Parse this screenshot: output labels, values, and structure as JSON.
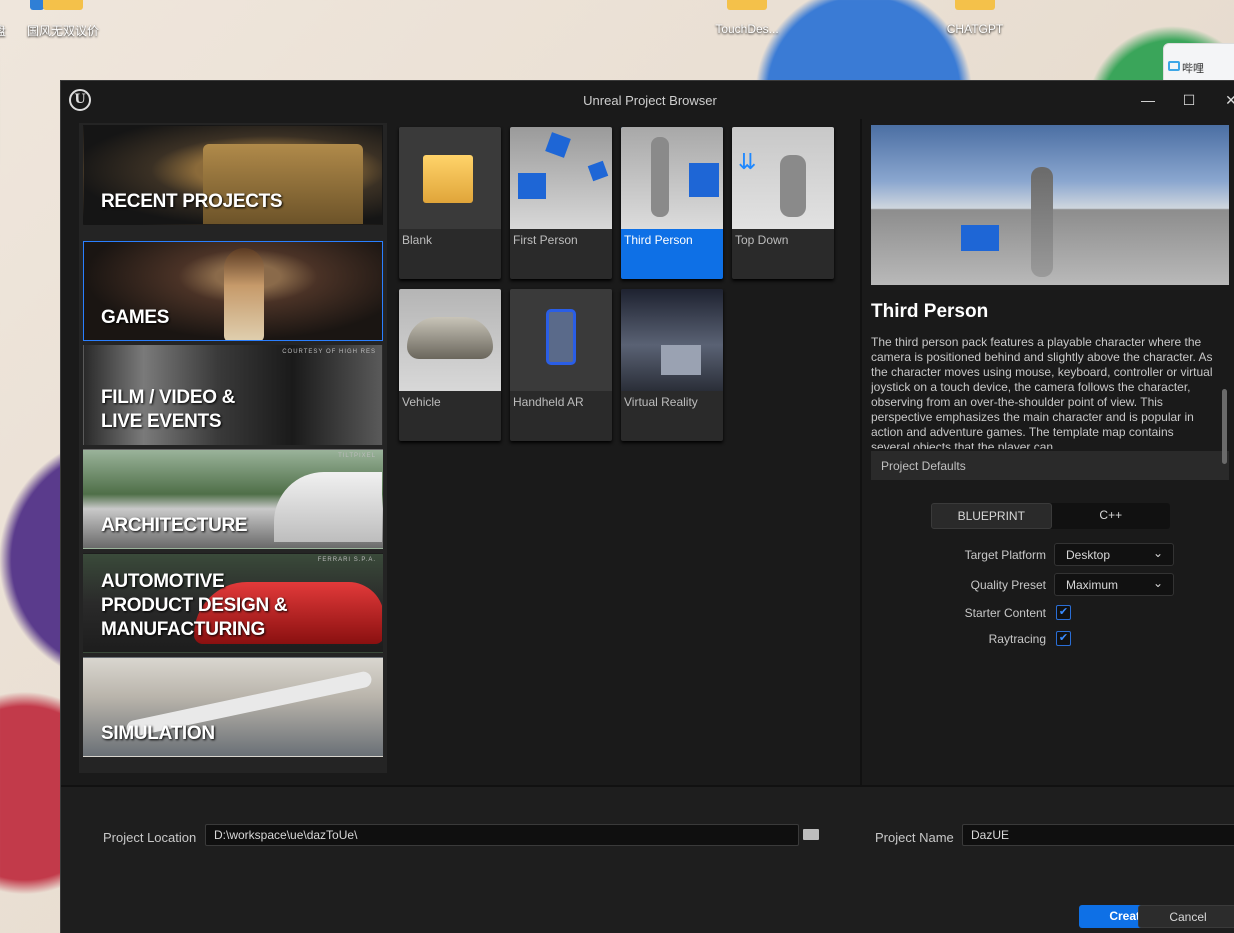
{
  "desktop": {
    "icons": [
      "盘",
      "国风无双议价",
      "TouchDes...",
      "CHATGPT"
    ],
    "edge_app_text": "哔哩"
  },
  "window": {
    "title": "Unreal Project Browser",
    "minimize": "—",
    "maximize": "☐",
    "close": "✕"
  },
  "categories": [
    {
      "label": "RECENT PROJECTS",
      "credit": ""
    },
    {
      "label": "GAMES",
      "credit": ""
    },
    {
      "label": "FILM / VIDEO &\nLIVE EVENTS",
      "credit": "COURTESY OF HIGH RES"
    },
    {
      "label": "ARCHITECTURE",
      "credit": "TILTPIXEL"
    },
    {
      "label": "AUTOMOTIVE\nPRODUCT DESIGN &\nMANUFACTURING",
      "credit": "FERRARI S.P.A."
    },
    {
      "label": "SIMULATION",
      "credit": ""
    }
  ],
  "templates": [
    {
      "name": "Blank"
    },
    {
      "name": "First Person"
    },
    {
      "name": "Third Person"
    },
    {
      "name": "Top Down"
    },
    {
      "name": "Vehicle"
    },
    {
      "name": "Handheld AR"
    },
    {
      "name": "Virtual Reality"
    }
  ],
  "selected_template": "Third Person",
  "detail": {
    "title": "Third Person",
    "description": "The third person pack features a playable character where the camera is positioned behind and slightly above the character. As the character moves using mouse, keyboard, controller or virtual joystick on a touch device, the camera follows the character, observing from an over-the-shoulder point of view. This perspective emphasizes the main character and is popular in action and adventure games. The template map contains several objects that the player can",
    "project_defaults": "Project Defaults",
    "blueprint": "BLUEPRINT",
    "cpp": "C++",
    "target_platform_label": "Target Platform",
    "target_platform_value": "Desktop",
    "quality_preset_label": "Quality Preset",
    "quality_preset_value": "Maximum",
    "starter_content_label": "Starter Content",
    "starter_content": true,
    "raytracing_label": "Raytracing",
    "raytracing": true
  },
  "footer": {
    "location_label": "Project Location",
    "location_value": "D:\\workspace\\ue\\dazToUe\\",
    "name_label": "Project Name",
    "name_value": "DazUE",
    "create": "Create",
    "cancel": "Cancel"
  },
  "colors": {
    "accent": "#0e70e6",
    "selection_border": "#2a7fff",
    "panel": "#242424",
    "window_bg": "#1a1a1a"
  }
}
